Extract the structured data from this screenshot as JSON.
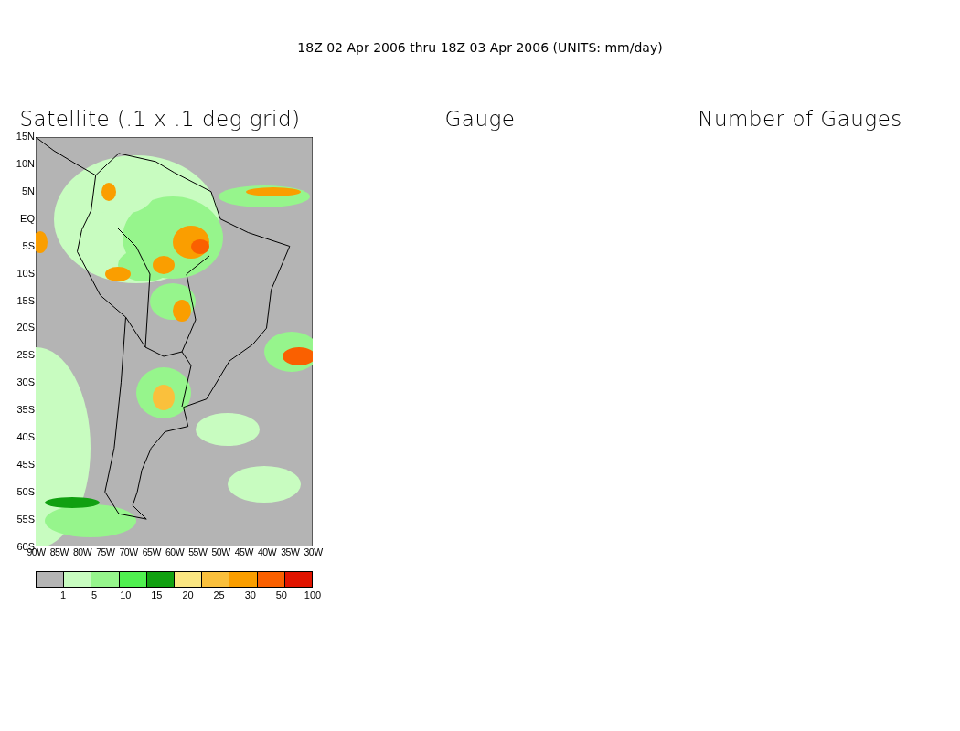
{
  "title": "18Z 02 Apr 2006 thru 18Z 03 Apr 2006 (UNITS: mm/day)",
  "panels": [
    {
      "kind": "map",
      "heading": "Satellite (.1 x .1 deg grid)"
    },
    {
      "kind": "empty",
      "heading": "Gauge"
    },
    {
      "kind": "empty",
      "heading": "Number of Gauges"
    }
  ],
  "lat_labels": [
    "15N",
    "10N",
    "5N",
    "EQ",
    "5S",
    "10S",
    "15S",
    "20S",
    "25S",
    "30S",
    "35S",
    "40S",
    "45S",
    "50S",
    "55S",
    "60S"
  ],
  "lon_labels": [
    "90W",
    "85W",
    "80W",
    "75W",
    "70W",
    "65W",
    "60W",
    "55W",
    "50W",
    "45W",
    "40W",
    "35W",
    "30W"
  ],
  "color_bar": {
    "swatches": [
      {
        "color": "#b4b4b4"
      },
      {
        "color": "#c8fcc0"
      },
      {
        "color": "#96f58c"
      },
      {
        "color": "#50f050"
      },
      {
        "color": "#11a011"
      },
      {
        "color": "#fae682"
      },
      {
        "color": "#fac03c"
      },
      {
        "color": "#fa9e00"
      },
      {
        "color": "#fa6000"
      },
      {
        "color": "#e11400"
      }
    ],
    "labels": [
      "1",
      "5",
      "10",
      "15",
      "20",
      "25",
      "30",
      "50",
      "100"
    ]
  }
}
